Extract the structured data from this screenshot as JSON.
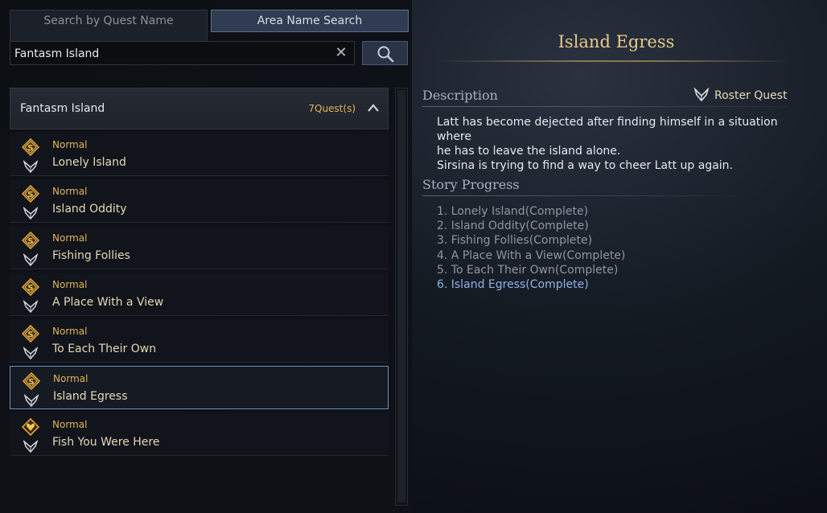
{
  "search": {
    "tabs": [
      {
        "label": "Search by Quest Name",
        "active": false
      },
      {
        "label": "Area Name Search",
        "active": true
      }
    ],
    "value": "Fantasm Island",
    "clear_icon": "close-icon",
    "search_icon": "magnifier-icon"
  },
  "group": {
    "title": "Fantasm Island",
    "count": "7Quest(s)",
    "collapse_icon": "chevron-up-icon"
  },
  "quests": [
    {
      "type": "Normal",
      "name": "Lonely Island",
      "icon": "quest-scroll-icon",
      "roster": true
    },
    {
      "type": "Normal",
      "name": "Island Oddity",
      "icon": "quest-scroll-icon",
      "roster": true
    },
    {
      "type": "Normal",
      "name": "Fishing Follies",
      "icon": "quest-scroll-icon",
      "roster": true
    },
    {
      "type": "Normal",
      "name": "A Place With a View",
      "icon": "quest-scroll-icon",
      "roster": true
    },
    {
      "type": "Normal",
      "name": "To Each Their Own",
      "icon": "quest-scroll-icon",
      "roster": true
    },
    {
      "type": "Normal",
      "name": "Island Egress",
      "icon": "quest-scroll-icon",
      "roster": true,
      "selected": true
    },
    {
      "type": "Normal",
      "name": "Fish You Were Here",
      "icon": "quest-heart-icon",
      "roster": true
    }
  ],
  "detail": {
    "title": "Island Egress",
    "description_heading": "Description",
    "roster_label": "Roster Quest",
    "description_lines": [
      "Latt has become dejected after finding himself in a situation where",
      "he has to leave the island alone.",
      "Sirsina is trying to find a way to cheer Latt up again."
    ],
    "progress_heading": "Story Progress",
    "progress": [
      "1. Lonely Island(Complete)",
      "2. Island Oddity(Complete)",
      "3. Fishing Follies(Complete)",
      "4. A Place With a View(Complete)",
      "5. To Each Their Own(Complete)",
      "6. Island Egress(Complete)"
    ],
    "current_progress_index": 5
  },
  "colors": {
    "accent_gold": "#e0b45a",
    "title_gold": "#e7c98c",
    "selected_border": "#6b8fc4",
    "current_progress": "#8fb2e6"
  }
}
